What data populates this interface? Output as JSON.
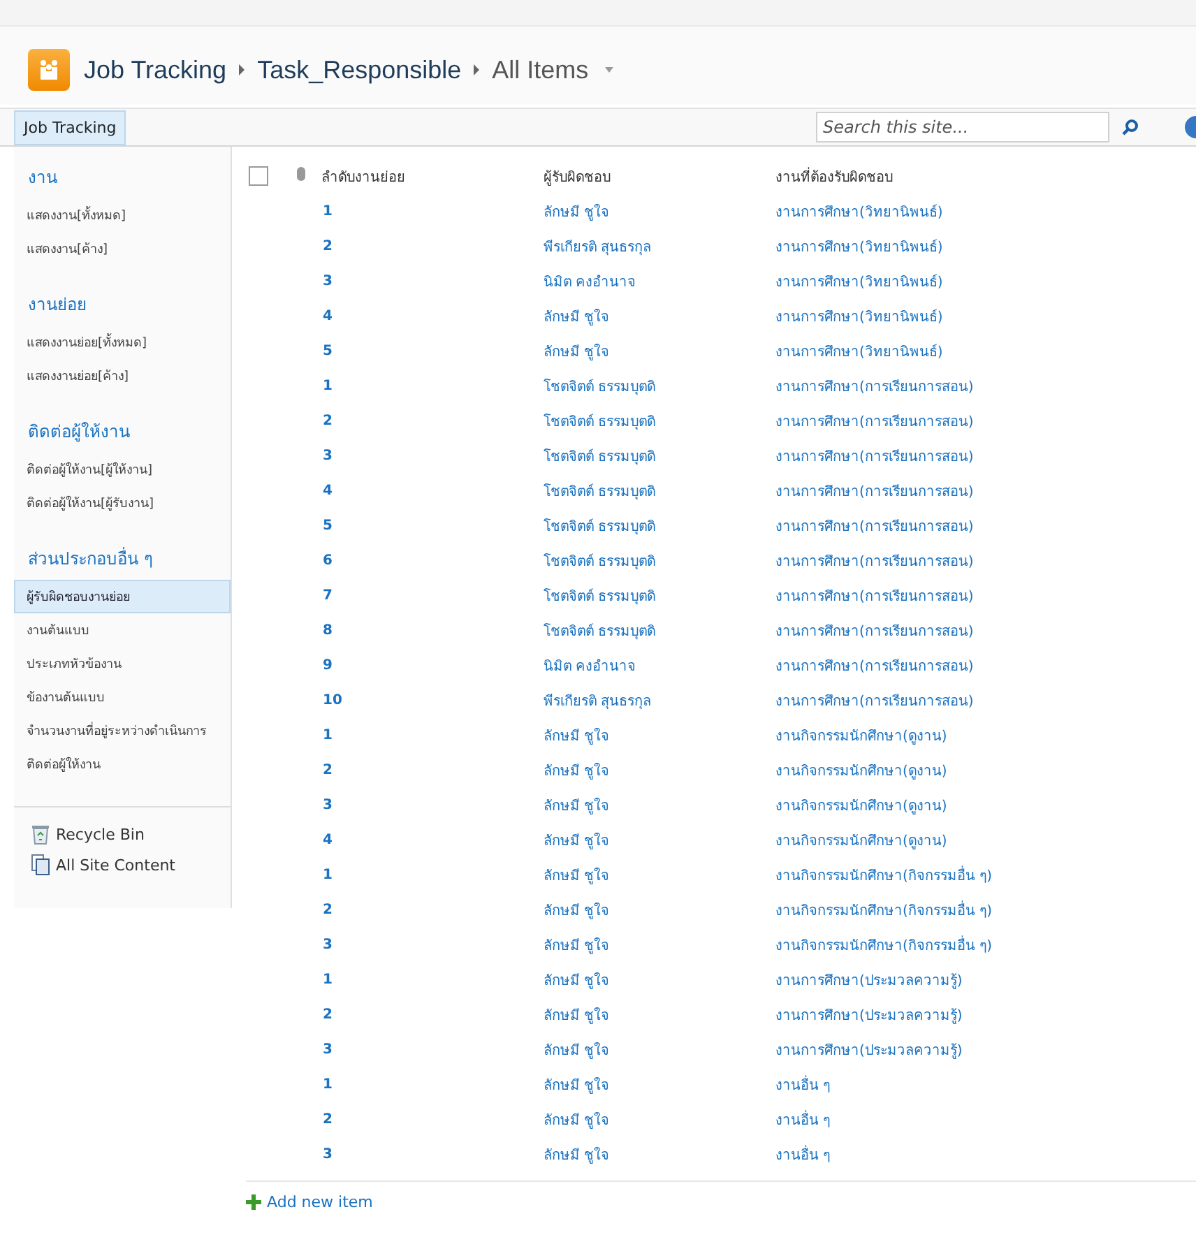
{
  "breadcrumb": [
    {
      "label": "Job Tracking",
      "kind": "link"
    },
    {
      "label": "Task_Responsible",
      "kind": "link"
    },
    {
      "label": "All Items",
      "kind": "view"
    }
  ],
  "top_bar": {
    "tab": "Job Tracking",
    "search": {
      "placeholder": "Search this site..."
    }
  },
  "sidebar": {
    "sections": [
      {
        "heading": "งาน",
        "items": [
          {
            "label": "แสดงงาน[ทั้งหมด]",
            "selected": false
          },
          {
            "label": "แสดงงาน[ค้าง]",
            "selected": false
          }
        ]
      },
      {
        "heading": "งานย่อย",
        "items": [
          {
            "label": "แสดงงานย่อย[ทั้งหมด]",
            "selected": false
          },
          {
            "label": "แสดงงานย่อย[ค้าง]",
            "selected": false
          }
        ]
      },
      {
        "heading": "ติดต่อผู้ให้งาน",
        "items": [
          {
            "label": "ติดต่อผู้ให้งาน[ผู้ให้งาน]",
            "selected": false
          },
          {
            "label": "ติดต่อผู้ให้งาน[ผู้รับงาน]",
            "selected": false
          }
        ]
      },
      {
        "heading": "ส่วนประกอบอื่น ๆ",
        "items": [
          {
            "label": "ผู้รับผิดชอบงานย่อย",
            "selected": true
          },
          {
            "label": "งานต้นแบบ",
            "selected": false
          },
          {
            "label": "ประเภทหัวข้องาน",
            "selected": false
          },
          {
            "label": "ข้องานต้นแบบ",
            "selected": false
          },
          {
            "label": "จำนวนงานที่อยู่ระหว่างดำเนินการ",
            "selected": false
          },
          {
            "label": "ติดต่อผู้ให้งาน",
            "selected": false
          }
        ]
      }
    ],
    "footer_links": [
      {
        "label": "Recycle Bin",
        "kind": "recycle"
      },
      {
        "label": "All Site Content",
        "kind": "content"
      }
    ]
  },
  "table": {
    "select_all": {
      "checked": false
    },
    "columns": [
      "ลำดับงานย่อย",
      "ผู้รับผิดชอบ",
      "งานที่ต้องรับผิดชอบ"
    ],
    "rows": [
      [
        "1",
        "ลักษมี ชูใจ",
        "งานการศึกษา(วิทยานิพนธ์)"
      ],
      [
        "2",
        "พีรเกียรติ สุนธรกุล",
        "งานการศึกษา(วิทยานิพนธ์)"
      ],
      [
        "3",
        "นิมิต คงอำนาจ",
        "งานการศึกษา(วิทยานิพนธ์)"
      ],
      [
        "4",
        "ลักษมี ชูใจ",
        "งานการศึกษา(วิทยานิพนธ์)"
      ],
      [
        "5",
        "ลักษมี ชูใจ",
        "งานการศึกษา(วิทยานิพนธ์)"
      ],
      [
        "1",
        "โชตจิตต์ ธรรมบุตดิ",
        "งานการศึกษา(การเรียนการสอน)"
      ],
      [
        "2",
        "โชตจิตต์ ธรรมบุตดิ",
        "งานการศึกษา(การเรียนการสอน)"
      ],
      [
        "3",
        "โชตจิตต์ ธรรมบุตดิ",
        "งานการศึกษา(การเรียนการสอน)"
      ],
      [
        "4",
        "โชตจิตต์ ธรรมบุตดิ",
        "งานการศึกษา(การเรียนการสอน)"
      ],
      [
        "5",
        "โชตจิตต์ ธรรมบุตดิ",
        "งานการศึกษา(การเรียนการสอน)"
      ],
      [
        "6",
        "โชตจิตต์ ธรรมบุตดิ",
        "งานการศึกษา(การเรียนการสอน)"
      ],
      [
        "7",
        "โชตจิตต์ ธรรมบุตดิ",
        "งานการศึกษา(การเรียนการสอน)"
      ],
      [
        "8",
        "โชตจิตต์ ธรรมบุตดิ",
        "งานการศึกษา(การเรียนการสอน)"
      ],
      [
        "9",
        "นิมิต คงอำนาจ",
        "งานการศึกษา(การเรียนการสอน)"
      ],
      [
        "10",
        "พีรเกียรติ สุนธรกุล",
        "งานการศึกษา(การเรียนการสอน)"
      ],
      [
        "1",
        "ลักษมี ชูใจ",
        "งานกิจกรรมนักศึกษา(ดูงาน)"
      ],
      [
        "2",
        "ลักษมี ชูใจ",
        "งานกิจกรรมนักศึกษา(ดูงาน)"
      ],
      [
        "3",
        "ลักษมี ชูใจ",
        "งานกิจกรรมนักศึกษา(ดูงาน)"
      ],
      [
        "4",
        "ลักษมี ชูใจ",
        "งานกิจกรรมนักศึกษา(ดูงาน)"
      ],
      [
        "1",
        "ลักษมี ชูใจ",
        "งานกิจกรรมนักศึกษา(กิจกรรมอื่น ๆ)"
      ],
      [
        "2",
        "ลักษมี ชูใจ",
        "งานกิจกรรมนักศึกษา(กิจกรรมอื่น ๆ)"
      ],
      [
        "3",
        "ลักษมี ชูใจ",
        "งานกิจกรรมนักศึกษา(กิจกรรมอื่น ๆ)"
      ],
      [
        "1",
        "ลักษมี ชูใจ",
        "งานการศึกษา(ประมวลความรู้)"
      ],
      [
        "2",
        "ลักษมี ชูใจ",
        "งานการศึกษา(ประมวลความรู้)"
      ],
      [
        "3",
        "ลักษมี ชูใจ",
        "งานการศึกษา(ประมวลความรู้)"
      ],
      [
        "1",
        "ลักษมี ชูใจ",
        "งานอื่น ๆ"
      ],
      [
        "2",
        "ลักษมี ชูใจ",
        "งานอื่น ๆ"
      ],
      [
        "3",
        "ลักษมี ชูใจ",
        "งานอื่น ๆ"
      ]
    ],
    "add_link": "Add new item"
  }
}
